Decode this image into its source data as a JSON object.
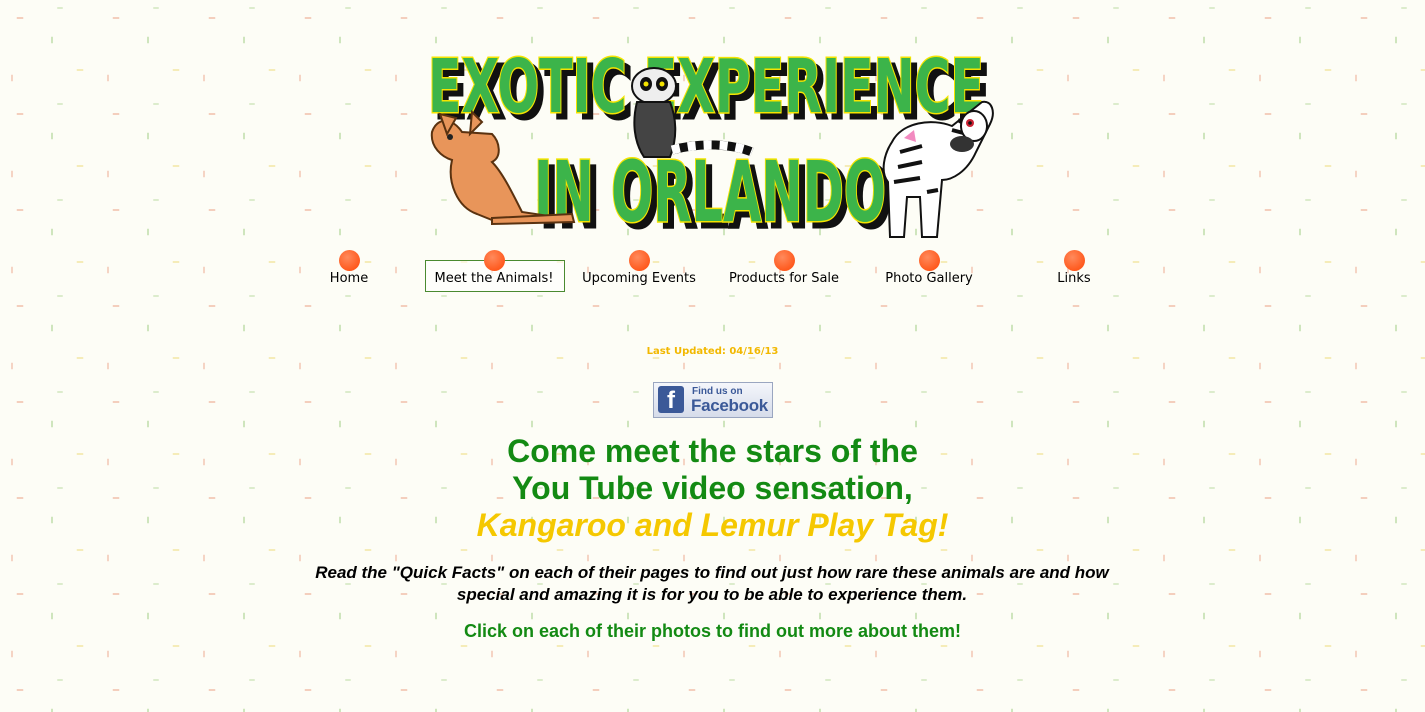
{
  "logo": {
    "line1": "EXOTIC EXPERIENCE",
    "line2": "IN ORLANDO",
    "colors": {
      "letters": "#3cb44a",
      "outline": "#f5e400",
      "shadow": "#111111"
    },
    "illustrations": [
      "kangaroo",
      "lemur",
      "zebra"
    ]
  },
  "nav": {
    "items": [
      {
        "label": "Home"
      },
      {
        "label": "Meet the Animals!",
        "active": true
      },
      {
        "label": "Upcoming Events"
      },
      {
        "label": "Products for Sale"
      },
      {
        "label": "Photo Gallery"
      },
      {
        "label": "Links"
      }
    ],
    "dot_color": "#ff5a1e"
  },
  "updated": "Last Updated:  04/16/13",
  "facebook": {
    "small": "Find us on",
    "big": "Facebook",
    "glyph": "f"
  },
  "headline": {
    "line1": "Come meet the stars of the",
    "line2": "You Tube video sensation,",
    "line3": "Kangaroo and Lemur Play Tag!"
  },
  "body_text": "Read the \"Quick Facts\" on each of their pages to find out just how rare these animals are and how special and amazing it is for you to be able to experience them.",
  "click_text": "Click on each of their photos to find out more about them!"
}
